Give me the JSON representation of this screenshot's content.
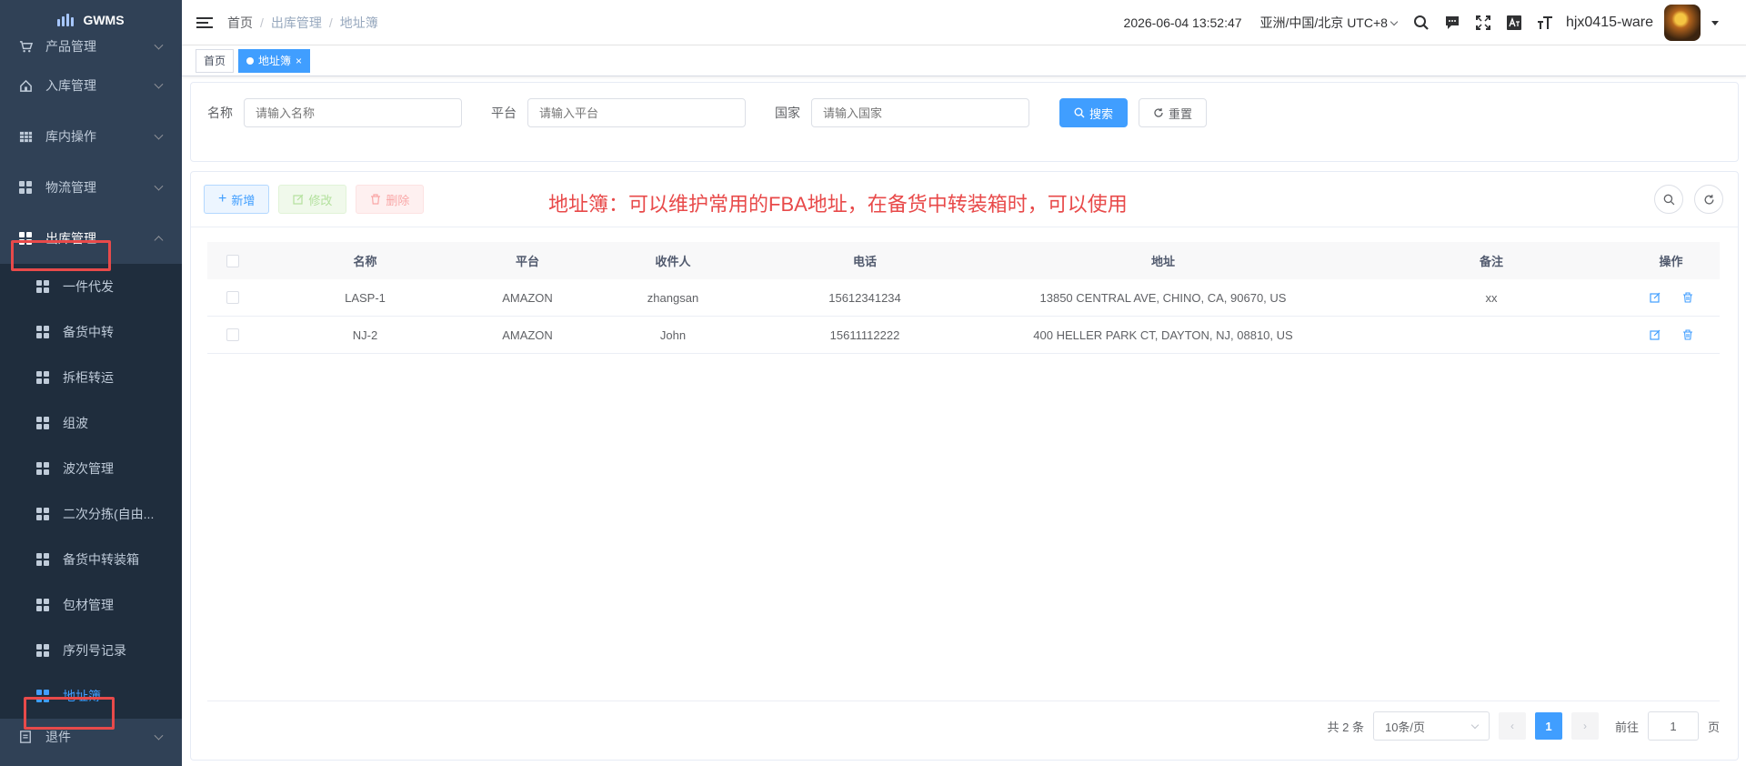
{
  "app": {
    "name": "GWMS"
  },
  "sidebar": {
    "items": [
      {
        "label": "产品管理",
        "icon": "cart-icon"
      },
      {
        "label": "入库管理",
        "icon": "home-icon"
      },
      {
        "label": "库内操作",
        "icon": "table-icon"
      },
      {
        "label": "物流管理",
        "icon": "grid-icon"
      },
      {
        "label": "出库管理",
        "icon": "grid-icon",
        "expanded": true
      },
      {
        "label": "退件",
        "icon": "document-icon"
      }
    ],
    "submenu": [
      {
        "label": "一件代发"
      },
      {
        "label": "备货中转"
      },
      {
        "label": "拆柜转运"
      },
      {
        "label": "组波"
      },
      {
        "label": "波次管理"
      },
      {
        "label": "二次分拣(自由..."
      },
      {
        "label": "备货中转装箱"
      },
      {
        "label": "包材管理"
      },
      {
        "label": "序列号记录"
      },
      {
        "label": "地址簿",
        "active": true
      }
    ]
  },
  "header": {
    "breadcrumb": [
      "首页",
      "出库管理",
      "地址簿"
    ],
    "datetime": "2026-06-04 13:52:47",
    "timezone": "亚洲/中国/北京 UTC+8",
    "username": "hjx0415-ware"
  },
  "tags": {
    "home": "首页",
    "current": "地址簿"
  },
  "search": {
    "name_label": "名称",
    "name_placeholder": "请输入名称",
    "platform_label": "平台",
    "platform_placeholder": "请输入平台",
    "country_label": "国家",
    "country_placeholder": "请输入国家",
    "search_button": "搜索",
    "reset_button": "重置"
  },
  "toolbar": {
    "add": "新增",
    "edit": "修改",
    "delete": "删除"
  },
  "annotation": "地址簿：可以维护常用的FBA地址，在备货中转装箱时，可以使用",
  "table": {
    "columns": [
      "名称",
      "平台",
      "收件人",
      "电话",
      "地址",
      "备注",
      "操作"
    ],
    "rows": [
      {
        "name": "LASP-1",
        "platform": "AMAZON",
        "recipient": "zhangsan",
        "phone": "15612341234",
        "address": "13850 CENTRAL AVE, CHINO, CA, 90670, US",
        "remark": "xx"
      },
      {
        "name": "NJ-2",
        "platform": "AMAZON",
        "recipient": "John",
        "phone": "15611112222",
        "address": "400 HELLER PARK CT, DAYTON, NJ, 08810, US",
        "remark": ""
      }
    ]
  },
  "pagination": {
    "total": "共 2 条",
    "page_size": "10条/页",
    "current_page": "1",
    "goto_label": "前往",
    "goto_value": "1",
    "page_suffix": "页"
  },
  "colors": {
    "primary": "#409eff",
    "sidebar_bg": "#304156",
    "highlight": "#e84a4a"
  }
}
